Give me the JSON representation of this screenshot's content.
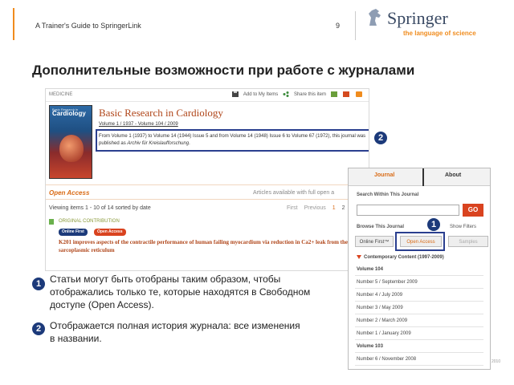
{
  "header": {
    "title": "A Trainer's Guide to SpringerLink",
    "page_number": "9",
    "logo": {
      "name": "Springer",
      "tagline": "the language of science"
    }
  },
  "slide_title": "Дополнительные возможности при работе с журналами",
  "journal_page": {
    "subject": "MEDICINE",
    "tools": {
      "add_to_items": "Add to My Items",
      "share": "Share this item"
    },
    "cover": {
      "title": "Cardiology",
      "subtitle": "Basic Research in"
    },
    "journal_title": "Basic Research in Cardiology",
    "volume_range": "Volume 1 / 1937 - Volume 104 / 2009",
    "history_note_pre": "From Volume 1 (1937) to Volume 14 (1944) Issue 5 and from Volume 14 (1948) Issue 6 to Volume 67 (1972), this journal was published as ",
    "history_note_italic": "Archiv für Kreislaufforschung",
    "history_note_post": ".",
    "open_access_title": "Open Access",
    "open_access_right": "Articles available with full open a",
    "viewing": "Viewing items 1 - 10 of 14 sorted by date",
    "pager": {
      "first": "First",
      "previous": "Previous",
      "current": "1",
      "next": "2"
    },
    "contribution_type": "ORIGINAL CONTRIBUTION",
    "badges": {
      "online_first": "Online First",
      "open_access": "Open Access"
    },
    "article_title": "K201 improves aspects of the contractile performance of human failing myocardium via reduction in Ca2+ leak from the sarcoplasmic reticulum"
  },
  "sidebar": {
    "tabs": {
      "journal": "Journal",
      "about": "About"
    },
    "search_label": "Search Within This Journal",
    "search_value": "",
    "go_button": "GO",
    "browse_label": "Browse This Journal",
    "show_filters": "Show Filters",
    "filters": {
      "online_first": "Online First™",
      "open_access": "Open Access",
      "samples": "Samples"
    },
    "contemporary": "Contemporary Content (1997-2009)",
    "rows": [
      {
        "label": "Volume 104",
        "kind": "vol"
      },
      {
        "label": "Number 5 / September 2009",
        "kind": "issue"
      },
      {
        "label": "Number 4 / July 2009",
        "kind": "issue"
      },
      {
        "label": "Number 3 / May 2009",
        "kind": "issue"
      },
      {
        "label": "Number 2 / March 2009",
        "kind": "issue"
      },
      {
        "label": "Number 1 / January 2009",
        "kind": "issue"
      },
      {
        "label": "Volume 103",
        "kind": "vol"
      },
      {
        "label": "Number 6 / November 2008",
        "kind": "issue"
      }
    ],
    "year_fragment": "2010"
  },
  "markers": {
    "one": "1",
    "two": "2"
  },
  "bullets": {
    "one": "Статьи могут быть отобраны таким образом, чтобы отображались только те, которые находятся в Свободном доступе (Open Access).",
    "two": "Отображается полная история журнала: все изменения в названии."
  },
  "colors": {
    "accent_orange": "#f08c1e",
    "marker_blue": "#1c3a7a",
    "highlight_blue": "#2a3f8f",
    "link_red": "#b0461a",
    "go_red": "#d9431f"
  }
}
